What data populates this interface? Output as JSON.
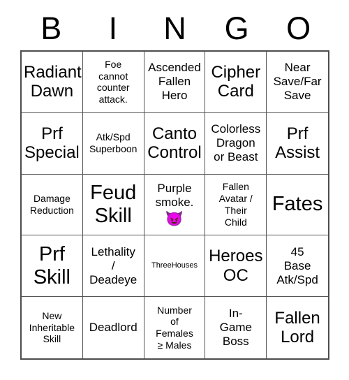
{
  "header": {
    "letters": [
      "B",
      "I",
      "N",
      "G",
      "O"
    ]
  },
  "grid": {
    "rows": 5,
    "columns": 5,
    "cells": [
      {
        "text": "Radiant\nDawn",
        "size": "lg"
      },
      {
        "text": "Foe\ncannot\ncounter\nattack.",
        "size": "sm"
      },
      {
        "text": "Ascended\nFallen\nHero",
        "size": "md"
      },
      {
        "text": "Cipher\nCard",
        "size": "lg"
      },
      {
        "text": "Near\nSave/Far\nSave",
        "size": "md"
      },
      {
        "text": "Prf\nSpecial",
        "size": "lg"
      },
      {
        "text": "Atk/Spd\nSuperboon",
        "size": "sm"
      },
      {
        "text": "Canto\nControl",
        "size": "lg"
      },
      {
        "text": "Colorless\nDragon\nor Beast",
        "size": "md"
      },
      {
        "text": "Prf\nAssist",
        "size": "lg"
      },
      {
        "text": "Damage\nReduction",
        "size": "sm"
      },
      {
        "text": "Feud\nSkill",
        "size": "xl"
      },
      {
        "text": "Purple\nsmoke.",
        "size": "md",
        "emoji": "😈",
        "emoji_name": "purple-devil-emoji",
        "emoji_color": "#ee00dd"
      },
      {
        "text": "Fallen\nAvatar /\nTheir\nChild",
        "size": "sm"
      },
      {
        "text": "Fates",
        "size": "xl"
      },
      {
        "text": "Prf\nSkill",
        "size": "xl"
      },
      {
        "text": "Lethality\n/\nDeadeye",
        "size": "md"
      },
      {
        "text": "ThreeHouses",
        "size": "xs"
      },
      {
        "text": "Heroes\nOC",
        "size": "lg"
      },
      {
        "text": "45\nBase\nAtk/Spd",
        "size": "md"
      },
      {
        "text": "New\nInheritable\nSkill",
        "size": "sm"
      },
      {
        "text": "Deadlord",
        "size": "md"
      },
      {
        "text": "Number\nof\nFemales\n≥ Males",
        "size": "sm"
      },
      {
        "text": "In-\nGame\nBoss",
        "size": "md"
      },
      {
        "text": "Fallen\nLord",
        "size": "lg"
      }
    ]
  },
  "colors": {
    "background": "#ffffff",
    "text": "#000000",
    "grid_line": "#555555",
    "grid_border": "#4d4d4d",
    "emoji_magenta": "#ee00dd"
  }
}
